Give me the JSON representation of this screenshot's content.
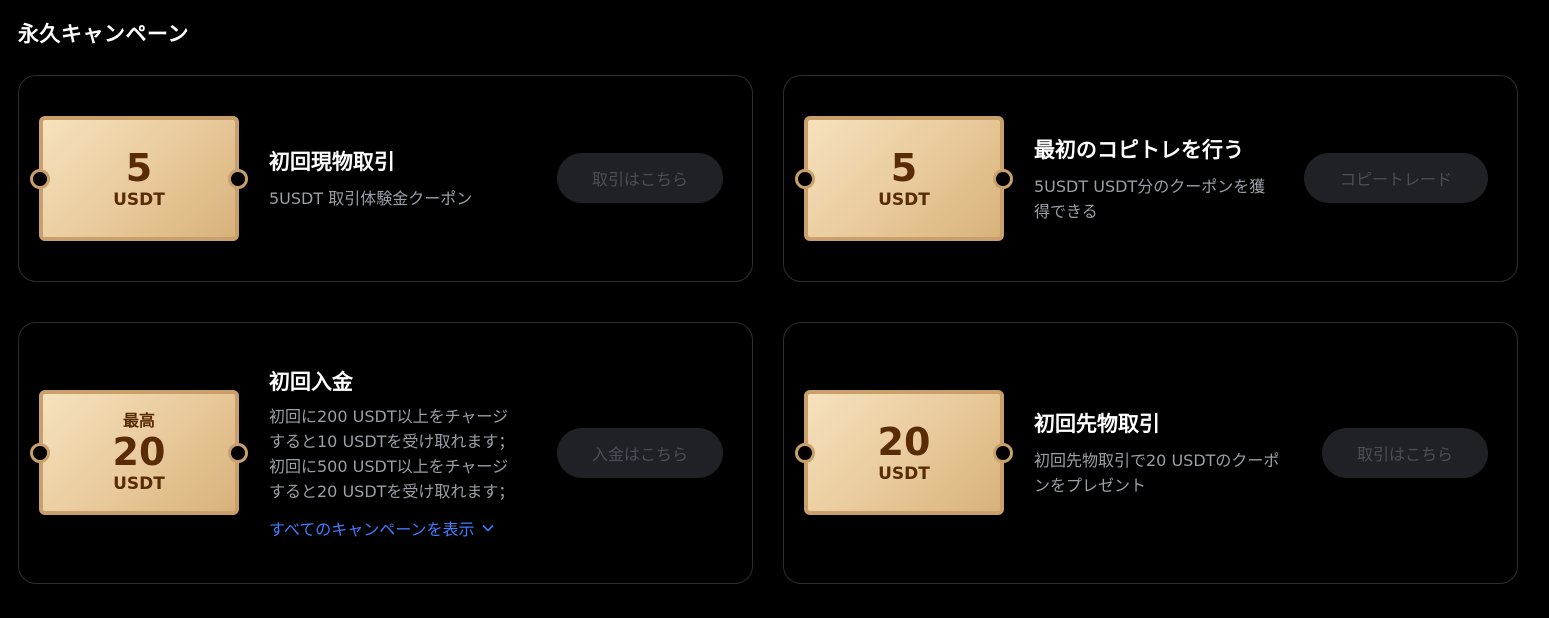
{
  "section": {
    "title": "永久キャンペーン"
  },
  "campaigns": [
    {
      "coupon": {
        "top": "",
        "amount": "5",
        "unit": "USDT"
      },
      "title": "初回現物取引",
      "description": [
        "5USDT 取引体験金クーポン"
      ],
      "button": "取引はこちら"
    },
    {
      "coupon": {
        "top": "",
        "amount": "5",
        "unit": "USDT"
      },
      "title": "最初のコピトレを行う",
      "description": [
        "5USDT USDT分のクーポンを獲",
        "得できる"
      ],
      "button": "コピートレード"
    },
    {
      "coupon": {
        "top": "最高",
        "amount": "20",
        "unit": "USDT"
      },
      "title": "初回入金",
      "description": [
        "初回に200 USDT以上をチャージ",
        "すると10 USDTを受け取れます；",
        "初回に500 USDT以上をチャージ",
        "すると20 USDTを受け取れます；"
      ],
      "link": "すべてのキャンペーンを表示",
      "button": "入金はこちら"
    },
    {
      "coupon": {
        "top": "",
        "amount": "20",
        "unit": "USDT"
      },
      "title": "初回先物取引",
      "description": [
        "初回先物取引で20 USDTのクーポ",
        "ンをプレゼント"
      ],
      "button": "取引はこちら"
    }
  ],
  "colors": {
    "background": "#000000",
    "card_border": "#2a2d33",
    "coupon_gold": "#e8c99a",
    "coupon_text": "#5a2c06",
    "link": "#3d7dff",
    "button_bg": "#1f2126",
    "button_text": "#4a4e56"
  },
  "icons": {
    "link_chevron": "chevron-down-icon"
  }
}
